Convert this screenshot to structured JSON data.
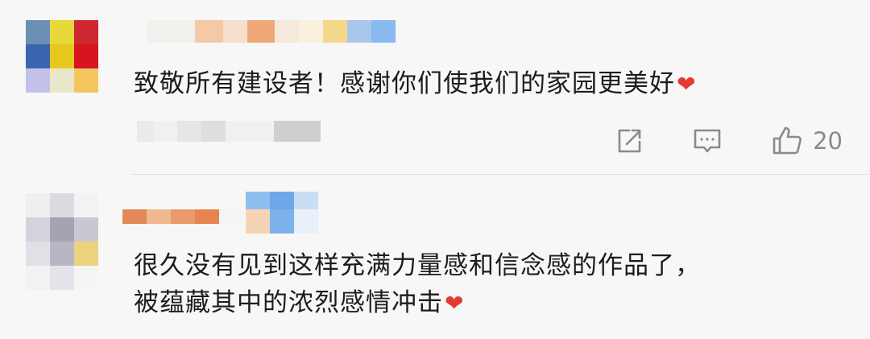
{
  "comments": [
    {
      "text_lines": [
        "致敬所有建设者！感谢你们使我们的家园更美好"
      ],
      "trailing_emoji": "❤",
      "actions": {
        "share_icon": "share-icon",
        "comment_icon": "comment-icon",
        "like_icon": "thumbs-up-icon",
        "like_count": "20"
      },
      "avatar_colors": [
        "#6d8fb5",
        "#e8d93a",
        "#cf2730",
        "#3a66b0",
        "#e8c81f",
        "#d8141f",
        "#c3c2e8",
        "#e9e7c9",
        "#f5c65f"
      ]
    },
    {
      "text_lines": [
        "很久没有见到这样充满力量感和信念感的作品了，",
        "被蕴藏其中的浓烈感情冲击"
      ],
      "trailing_emoji": "❤",
      "avatar_colors": [
        "#efeff1",
        "#dcdce0",
        "#f3f3f5",
        "#d4d3dc",
        "#a6a2b2",
        "#c9c7d1",
        "#e1e0e6",
        "#b9b6c4",
        "#edd27d"
      ]
    }
  ],
  "colors": {
    "background": "#f7f7f7",
    "text": "#1c1c1c",
    "muted": "#8a8a8a",
    "heart": "#e53935",
    "divider": "#e1e1e1"
  }
}
